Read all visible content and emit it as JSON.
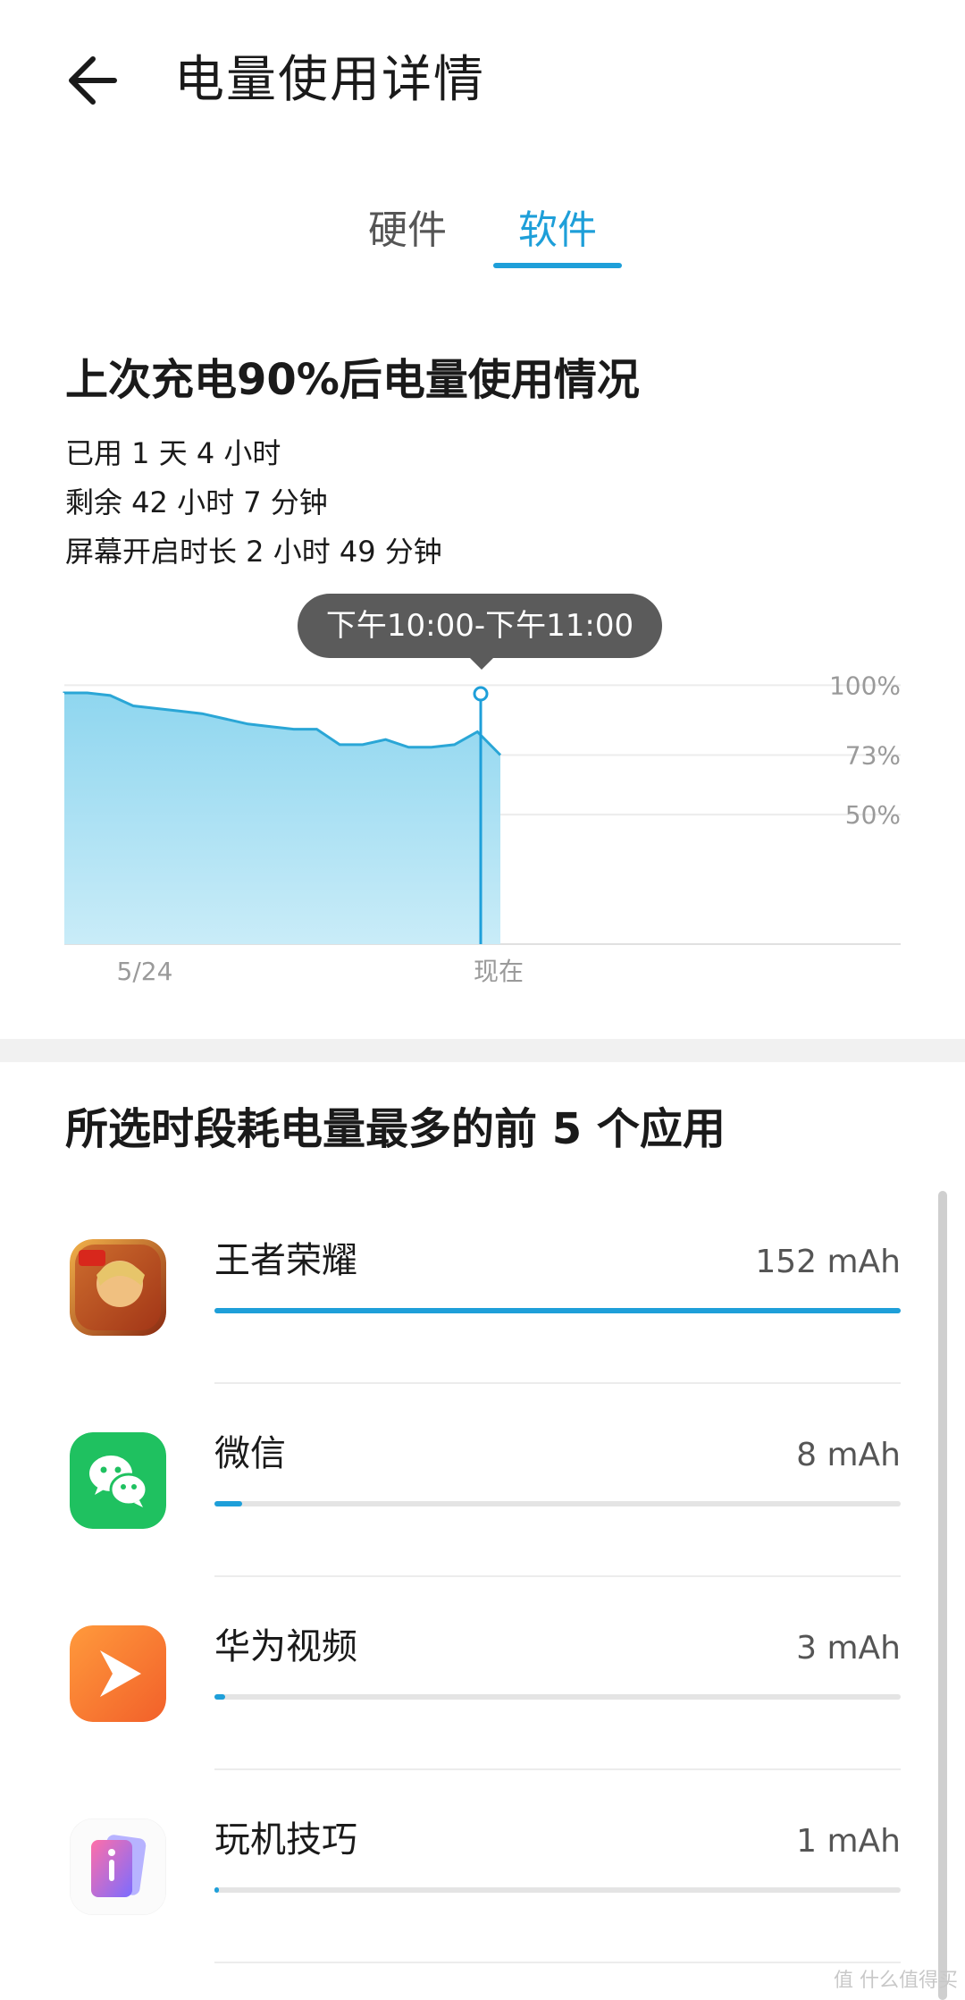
{
  "header": {
    "title": "电量使用详情"
  },
  "tabs": [
    {
      "label": "硬件",
      "active": false
    },
    {
      "label": "软件",
      "active": true
    }
  ],
  "summary": {
    "heading": "上次充电90%后电量使用情况",
    "used": "已用 1 天 4 小时",
    "remaining": "剩余 42 小时 7 分钟",
    "screen_on": "屏幕开启时长 2 小时 49 分钟"
  },
  "chart_data": {
    "type": "area",
    "tooltip": "下午10:00-下午11:00",
    "y_tick_labels": [
      "100%",
      "73%",
      "50%"
    ],
    "x_tick_labels": [
      "5/24",
      "现在"
    ],
    "ylim": [
      0,
      100
    ],
    "grid": true,
    "series": [
      {
        "values": [
          97,
          97,
          96,
          92,
          91,
          90,
          89,
          87,
          85,
          84,
          83,
          83,
          77,
          77,
          79,
          76,
          76,
          77,
          82,
          73
        ]
      }
    ],
    "selected_index": 17
  },
  "apps_section": {
    "heading": "所选时段耗电量最多的前 5 个应用",
    "apps": [
      {
        "name": "王者荣耀",
        "value": "152 mAh",
        "fraction": 1.0,
        "icon": "honor-of-kings-icon"
      },
      {
        "name": "微信",
        "value": "8 mAh",
        "fraction": 0.04,
        "icon": "wechat-icon"
      },
      {
        "name": "华为视频",
        "value": "3 mAh",
        "fraction": 0.015,
        "icon": "huawei-video-icon"
      },
      {
        "name": "玩机技巧",
        "value": "1 mAh",
        "fraction": 0.005,
        "icon": "tips-icon"
      }
    ]
  },
  "watermark": "值 什么值得买"
}
